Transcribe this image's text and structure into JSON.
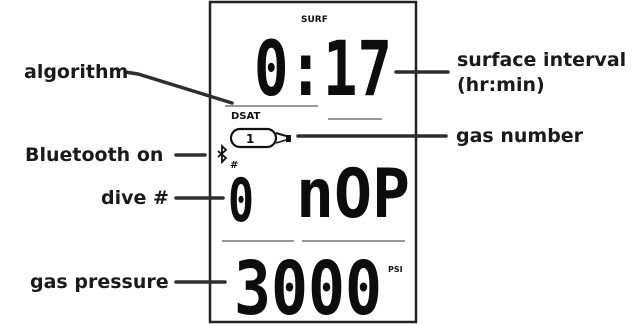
{
  "display": {
    "surf_label": "SURF",
    "surface_time": "0:17",
    "algorithm_label": "DSAT",
    "gas_number": "1",
    "dive_marker": "#",
    "dive_number": "0",
    "status_text": "nOP",
    "pressure_value": "3000",
    "pressure_unit": "PSI"
  },
  "callouts": {
    "algorithm": "algorithm",
    "bluetooth": "Bluetooth on",
    "dive_number": "dive #",
    "gas_pressure": "gas pressure",
    "surface_interval_line1": "surface interval",
    "surface_interval_line2": "(hr:min)",
    "gas_number": "gas number"
  },
  "icons": [
    "bluetooth-icon",
    "gas-cylinder-icon"
  ],
  "colors": {
    "ink": "#0d0d0d",
    "leader": "#2e2e2e",
    "frame": "#222222",
    "background": "#ffffff"
  }
}
